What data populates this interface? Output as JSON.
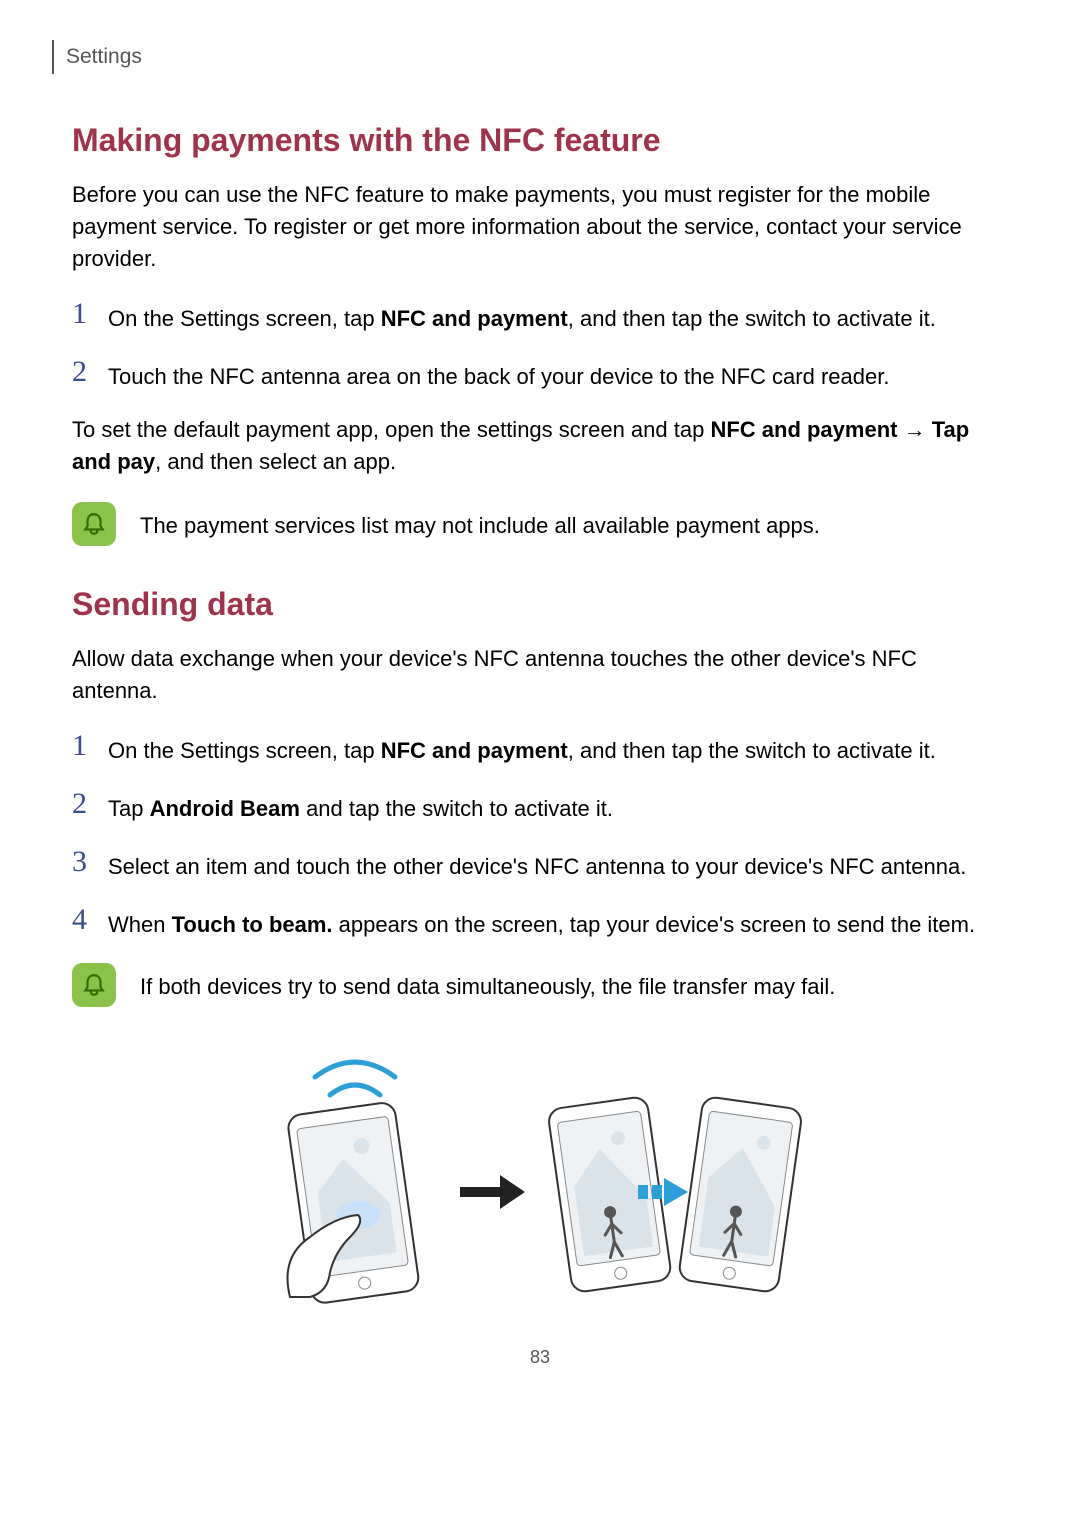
{
  "header": {
    "breadcrumb": "Settings"
  },
  "section1": {
    "heading": "Making payments with the NFC feature",
    "intro": "Before you can use the NFC feature to make payments, you must register for the mobile payment service. To register or get more information about the service, contact your service provider.",
    "steps": {
      "s1": {
        "num": "1",
        "pre": "On the Settings screen, tap ",
        "bold1": "NFC and payment",
        "post": ", and then tap the switch to activate it."
      },
      "s2": {
        "num": "2",
        "text": "Touch the NFC antenna area on the back of your device to the NFC card reader."
      }
    },
    "after_pre": "To set the default payment app, open the settings screen and tap ",
    "after_b1": "NFC and payment",
    "after_arrow": " → ",
    "after_b2": "Tap and pay",
    "after_post": ", and then select an app.",
    "note": "The payment services list may not include all available payment apps."
  },
  "section2": {
    "heading": "Sending data",
    "intro": "Allow data exchange when your device's NFC antenna touches the other device's NFC antenna.",
    "steps": {
      "s1": {
        "num": "1",
        "pre": "On the Settings screen, tap ",
        "bold1": "NFC and payment",
        "post": ", and then tap the switch to activate it."
      },
      "s2": {
        "num": "2",
        "pre": "Tap ",
        "bold1": "Android Beam",
        "post": " and tap the switch to activate it."
      },
      "s3": {
        "num": "3",
        "text": "Select an item and touch the other device's NFC antenna to your device's NFC antenna."
      },
      "s4": {
        "num": "4",
        "pre": "When ",
        "bold1": "Touch to beam.",
        "post": " appears on the screen, tap your device's screen to send the item."
      }
    },
    "note": "If both devices try to send data simultaneously, the file transfer may fail."
  },
  "page_number": "83"
}
